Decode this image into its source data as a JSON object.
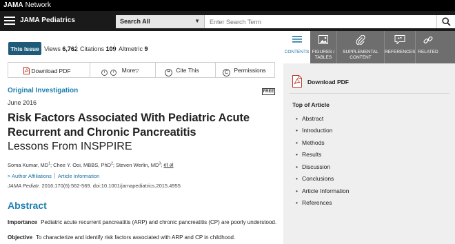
{
  "network": {
    "brand_bold": "JAMA",
    "brand_rest": " Network"
  },
  "header": {
    "journal": "JAMA Pediatrics",
    "search_category": "Search All",
    "search_placeholder": "Enter Search Term"
  },
  "stats": {
    "this_issue": "This Issue",
    "views_label": "Views",
    "views_value": "6,762",
    "citations_label": "Citations",
    "citations_value": "109",
    "altmetric_label": "Altmetric",
    "altmetric_value": "9"
  },
  "toolbar": {
    "download_pdf": "Download PDF",
    "more": "More",
    "cite_this": "Cite This",
    "permissions": "Permissions"
  },
  "article": {
    "type": "Original Investigation",
    "free_badge": "FREE",
    "date": "June 2016",
    "title_line1": "Risk Factors Associated With Pediatric Acute",
    "title_line2": "Recurrent and Chronic Pancreatitis",
    "subtitle": "Lessons From INSPPIRE",
    "author1": "Soma Kumar, MD",
    "author1_sup": "1",
    "author2": "; Chee Y. Ooi, MBBS, PhD",
    "author2_sup": "2",
    "author3": "; Steven Werlin, MD",
    "author3_sup": "3",
    "author_sep": "; ",
    "et_al": "et al",
    "author_affiliations": "> Author Affiliations",
    "article_information": "Article Information",
    "citation_journal": "JAMA Pediatr.",
    "citation_rest": " 2016;170(6):562-569. doi:10.1001/jamapediatrics.2015.4955"
  },
  "abstract": {
    "heading": "Abstract",
    "importance_label": "Importance",
    "importance_text": "Pediatric acute recurrent pancreatitis (ARP) and chronic pancreatitis (CP) are poorly understood.",
    "objective_label": "Objective",
    "objective_text": "To characterize and identify risk factors associated with ARP and CP in childhood."
  },
  "rail": {
    "tabs": [
      "CONTENTS",
      "FIGURES / TABLES",
      "SUPPLEMENTAL CONTENT",
      "REFERENCES",
      "RELATED"
    ],
    "download_pdf": "Download PDF",
    "toc_heading": "Top of Article",
    "toc_items": [
      "Abstract",
      "Introduction",
      "Methods",
      "Results",
      "Discussion",
      "Conclusions",
      "Article Information",
      "References"
    ]
  },
  "colors": {
    "accent": "#1d7fb0",
    "this_issue_bg": "#1d5b78",
    "header_bg": "#1a1a1a",
    "rail_bg": "#efefef"
  }
}
